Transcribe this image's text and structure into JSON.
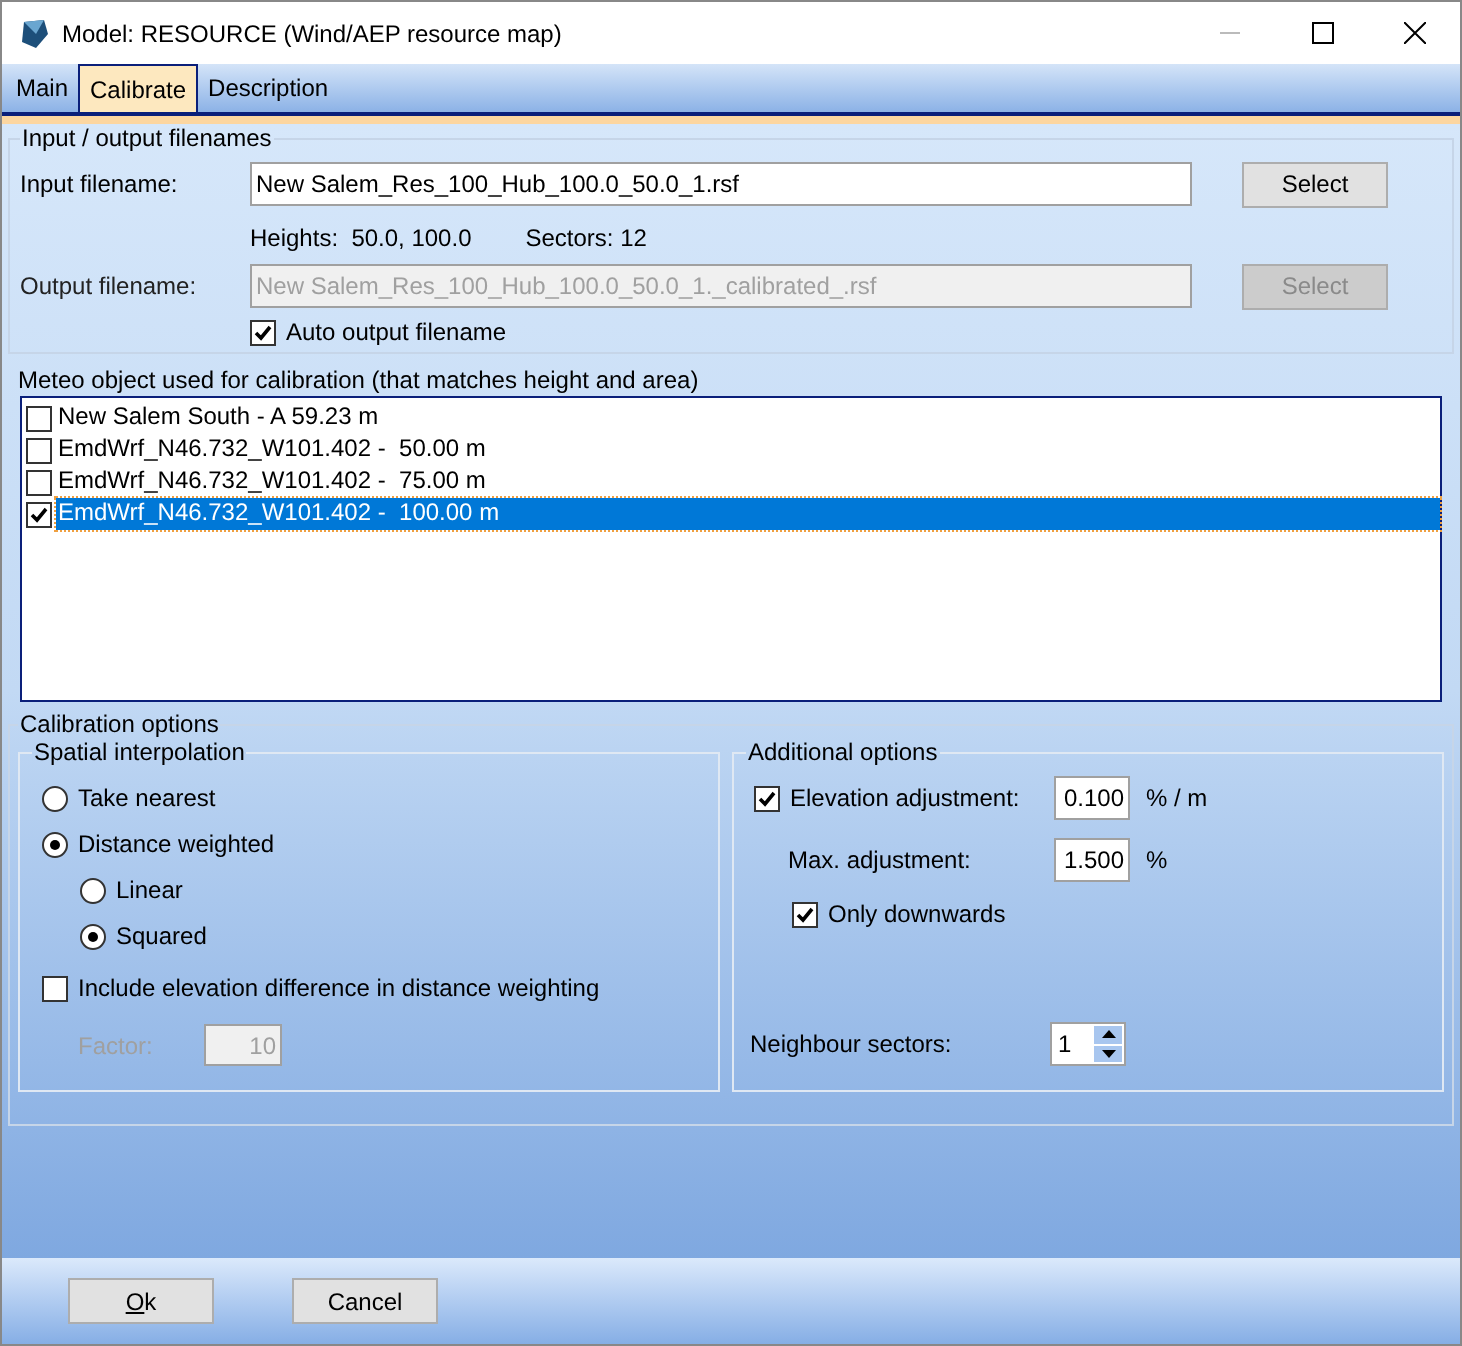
{
  "window": {
    "title": "Model: RESOURCE (Wind/AEP resource map)"
  },
  "tabs": [
    {
      "label": "Main",
      "selected": false
    },
    {
      "label": "Calibrate",
      "selected": true
    },
    {
      "label": "Description",
      "selected": false
    }
  ],
  "input_output": {
    "title": "Input / output filenames",
    "input": {
      "label": "Input filename:",
      "value": "New Salem_Res_100_Hub_100.0_50.0_1.rsf",
      "button": "Select",
      "disabled": false
    },
    "info": [
      "Heights:  50.0, 100.0",
      "Sectors: 12"
    ],
    "output": {
      "label": "Output filename:",
      "value": "New Salem_Res_100_Hub_100.0_50.0_1._calibrated_.rsf",
      "button": "Select",
      "disabled": true
    },
    "auto_output": {
      "label": "Auto output filename",
      "checked": true
    }
  },
  "meteo": {
    "title": "Meteo object used for calibration (that matches height and area)",
    "items": [
      {
        "label": "New Salem South - A 59.23 m",
        "checked": false,
        "selected": false
      },
      {
        "label": "EmdWrf_N46.732_W101.402 -  50.00 m",
        "checked": false,
        "selected": false
      },
      {
        "label": "EmdWrf_N46.732_W101.402 -  75.00 m",
        "checked": false,
        "selected": false
      },
      {
        "label": "EmdWrf_N46.732_W101.402 -  100.00 m",
        "checked": true,
        "selected": true
      }
    ]
  },
  "calibration": {
    "title": "Calibration options",
    "spatial": {
      "title": "Spatial interpolation",
      "options": [
        {
          "label": "Take nearest",
          "selected": false
        },
        {
          "label": "Distance weighted",
          "selected": true,
          "children": [
            {
              "label": "Linear",
              "selected": false
            },
            {
              "label": "Squared",
              "selected": true
            }
          ]
        }
      ],
      "include_elevation": {
        "label": "Include elevation difference in distance weighting",
        "checked": false
      },
      "factor": {
        "label": "Factor:",
        "value": "10",
        "disabled": true
      }
    },
    "additional": {
      "title": "Additional options",
      "elevation_adjustment": {
        "label": "Elevation adjustment:",
        "checked": true,
        "value": "0.100",
        "unit": "% / m"
      },
      "max_adjustment": {
        "label": "Max. adjustment:",
        "value": "1.500",
        "unit": "%"
      },
      "only_downwards": {
        "label": "Only downwards",
        "checked": true
      },
      "neighbour_sectors": {
        "label": "Neighbour sectors:",
        "value": "1"
      }
    }
  },
  "buttons": [
    "Ok",
    "Cancel"
  ]
}
